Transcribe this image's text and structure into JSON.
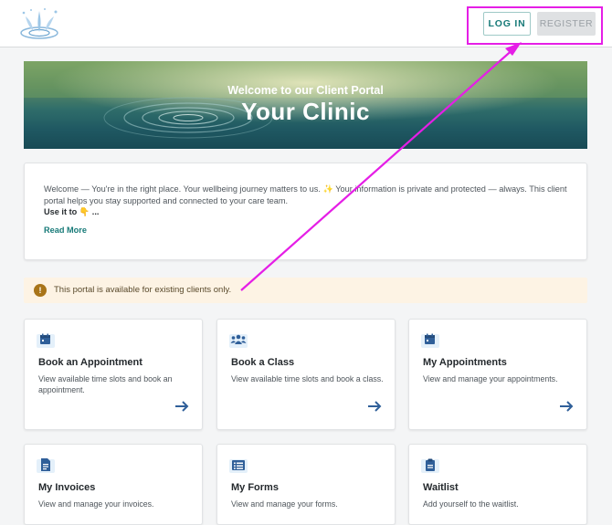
{
  "header": {
    "login_label": "LOG IN",
    "register_label": "REGISTER"
  },
  "hero": {
    "subtitle": "Welcome to our Client Portal",
    "title": "Your Clinic"
  },
  "welcome": {
    "text": "Welcome — You're in the right place. Your wellbeing journey matters to us. ✨ Your information is private and protected — always. This client portal helps you stay supported and connected to your care team.",
    "use_it": "Use it to 👇 ...",
    "read_more": "Read More"
  },
  "notice": {
    "icon_glyph": "!",
    "text": "This portal is available for existing clients only."
  },
  "cards": [
    {
      "title": "Book an Appointment",
      "desc": "View available time slots and book an appointment.",
      "icon": "calendar-icon"
    },
    {
      "title": "Book a Class",
      "desc": "View available time slots and book a class.",
      "icon": "group-icon"
    },
    {
      "title": "My Appointments",
      "desc": "View and manage your appointments.",
      "icon": "calendar-icon"
    },
    {
      "title": "My Invoices",
      "desc": "View and manage your invoices.",
      "icon": "document-icon"
    },
    {
      "title": "My Forms",
      "desc": "View and manage your forms.",
      "icon": "list-icon"
    },
    {
      "title": "Waitlist",
      "desc": "Add yourself to the waitlist.",
      "icon": "clipboard-icon"
    }
  ],
  "colors": {
    "accent": "#177a78",
    "annotation": "#e51ee6",
    "icon_blue": "#2f5f99",
    "notice_bg": "#fdf3e4"
  }
}
